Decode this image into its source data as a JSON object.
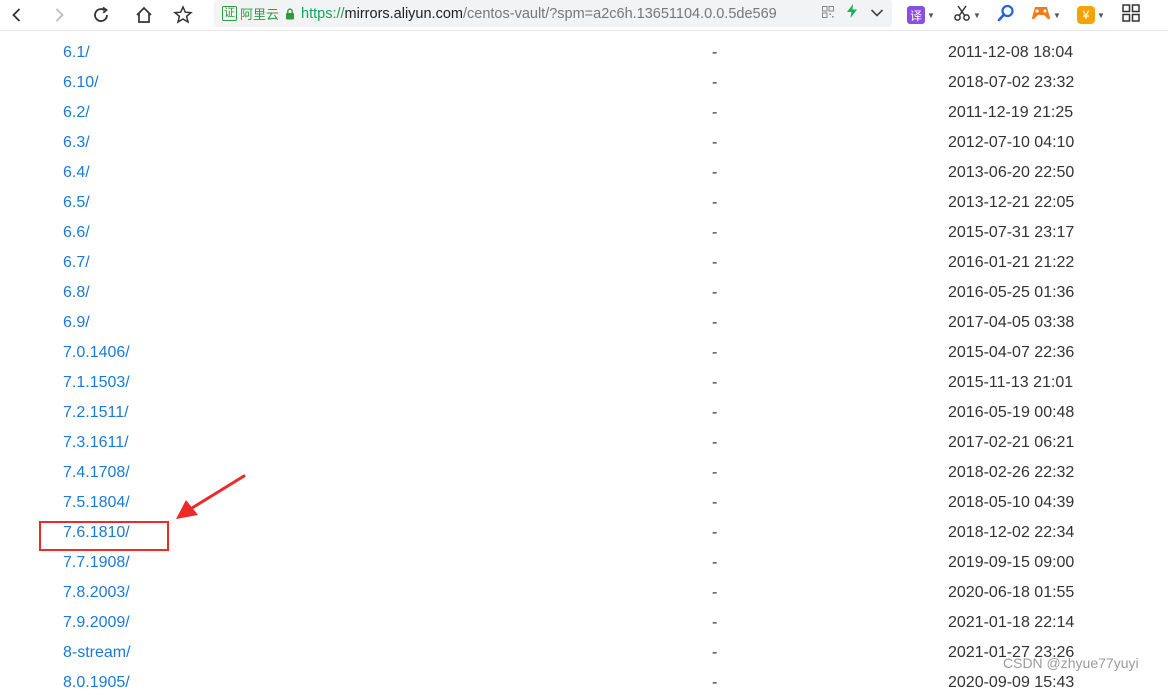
{
  "browser": {
    "cert_badge": "证",
    "cert_label": "阿里云",
    "url_protocol": "https://",
    "url_host": "mirrors.aliyun.com",
    "url_path": "/centos-vault/?spm=a2c6h.13651104.0.0.5de569",
    "translate_badge": "译",
    "money_badge": "¥",
    "icons": [
      "back-icon",
      "forward-icon",
      "reload-icon",
      "home-icon",
      "star-icon",
      "lock-icon",
      "qr-icon",
      "bolt-icon",
      "chevron-down-icon",
      "scissors-icon",
      "search-icon",
      "game-icon",
      "grid-icon"
    ]
  },
  "listing": {
    "rows": [
      {
        "name": "6.1/",
        "size": "-",
        "date": "2011-12-08 18:04"
      },
      {
        "name": "6.10/",
        "size": "-",
        "date": "2018-07-02 23:32"
      },
      {
        "name": "6.2/",
        "size": "-",
        "date": "2011-12-19 21:25"
      },
      {
        "name": "6.3/",
        "size": "-",
        "date": "2012-07-10 04:10"
      },
      {
        "name": "6.4/",
        "size": "-",
        "date": "2013-06-20 22:50"
      },
      {
        "name": "6.5/",
        "size": "-",
        "date": "2013-12-21 22:05"
      },
      {
        "name": "6.6/",
        "size": "-",
        "date": "2015-07-31 23:17"
      },
      {
        "name": "6.7/",
        "size": "-",
        "date": "2016-01-21 21:22"
      },
      {
        "name": "6.8/",
        "size": "-",
        "date": "2016-05-25 01:36"
      },
      {
        "name": "6.9/",
        "size": "-",
        "date": "2017-04-05 03:38"
      },
      {
        "name": "7.0.1406/",
        "size": "-",
        "date": "2015-04-07 22:36"
      },
      {
        "name": "7.1.1503/",
        "size": "-",
        "date": "2015-11-13 21:01"
      },
      {
        "name": "7.2.1511/",
        "size": "-",
        "date": "2016-05-19 00:48"
      },
      {
        "name": "7.3.1611/",
        "size": "-",
        "date": "2017-02-21 06:21"
      },
      {
        "name": "7.4.1708/",
        "size": "-",
        "date": "2018-02-26 22:32"
      },
      {
        "name": "7.5.1804/",
        "size": "-",
        "date": "2018-05-10 04:39"
      },
      {
        "name": "7.6.1810/",
        "size": "-",
        "date": "2018-12-02 22:34"
      },
      {
        "name": "7.7.1908/",
        "size": "-",
        "date": "2019-09-15 09:00"
      },
      {
        "name": "7.8.2003/",
        "size": "-",
        "date": "2020-06-18 01:55"
      },
      {
        "name": "7.9.2009/",
        "size": "-",
        "date": "2021-01-18 22:14"
      },
      {
        "name": "8-stream/",
        "size": "-",
        "date": "2021-01-27 23:26"
      },
      {
        "name": "8.0.1905/",
        "size": "-",
        "date": "2020-09-09 15:43"
      }
    ]
  },
  "annotation": {
    "color": "#ec2a2a"
  },
  "watermark": "CSDN @zhyue77yuyi"
}
